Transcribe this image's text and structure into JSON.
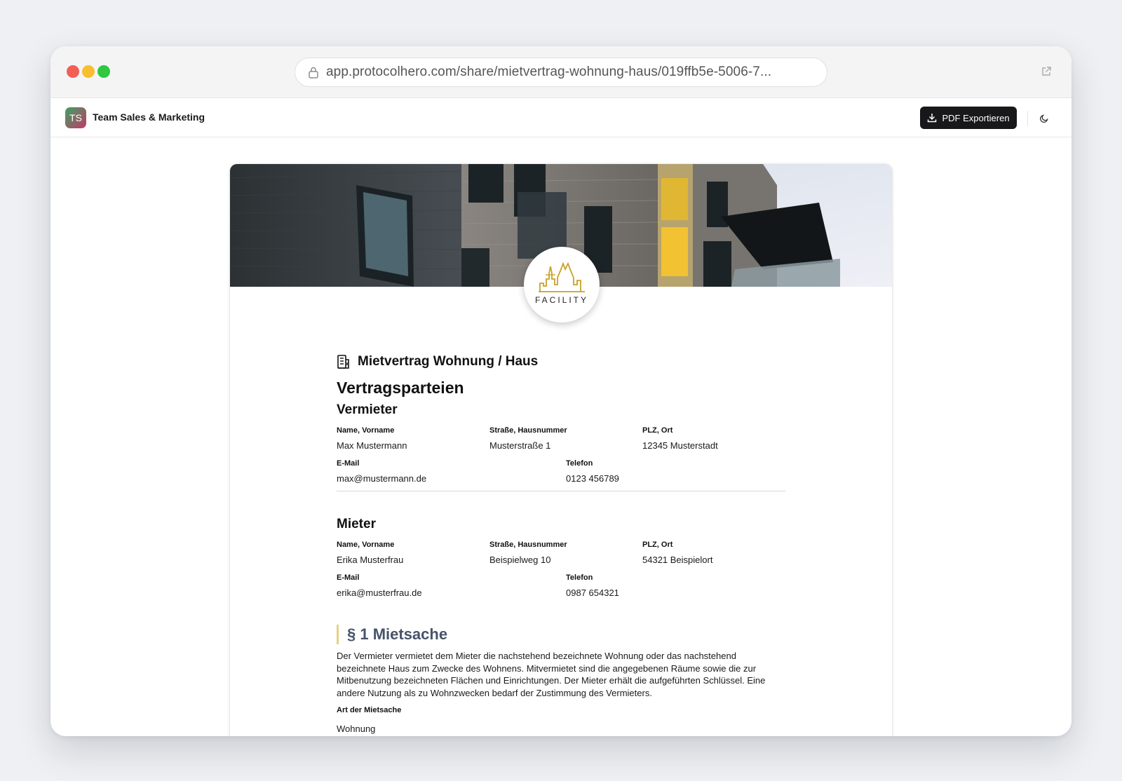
{
  "browser": {
    "url": "app.protocolhero.com/share/mietvertrag-wohnung-haus/019ffb5e-5006-7..."
  },
  "appbar": {
    "avatar_initials": "TS",
    "team_name": "Team Sales & Marketing",
    "pdf_button_label": "PDF Exportieren"
  },
  "logo": {
    "text": "FACILITY"
  },
  "document": {
    "title": "Mietvertrag Wohnung / Haus",
    "heading": "Vertragsparteien",
    "vermieter": {
      "heading": "Vermieter",
      "name_label": "Name, Vorname",
      "name": "Max Mustermann",
      "street_label": "Straße, Hausnummer",
      "street": "Musterstraße 1",
      "city_label": "PLZ, Ort",
      "city": "12345 Musterstadt",
      "email_label": "E-Mail",
      "email": "max@mustermann.de",
      "phone_label": "Telefon",
      "phone": "0123 456789"
    },
    "mieter": {
      "heading": "Mieter",
      "name_label": "Name, Vorname",
      "name": "Erika Musterfrau",
      "street_label": "Straße, Hausnummer",
      "street": "Beispielweg 10",
      "city_label": "PLZ, Ort",
      "city": "54321 Beispielort",
      "email_label": "E-Mail",
      "email": "erika@musterfrau.de",
      "phone_label": "Telefon",
      "phone": "0987 654321"
    },
    "section1": {
      "title": "§ 1 Mietsache",
      "text": "Der Vermieter vermietet dem Mieter die nachstehend bezeichnete Wohnung oder das nachstehend bezeichnete Haus zum Zwecke des Wohnens. Mitvermietet sind die angegebenen Räume sowie die zur Mitbenutzung bezeichneten Flächen und Einrichtungen. Der Mieter erhält die aufgeführten Schlüssel. Eine andere Nutzung als zu Wohnzwecken bedarf der Zustimmung des Vermieters.",
      "art_label": "Art der Mietsache",
      "art_value": "Wohnung"
    }
  },
  "colors": {
    "accent_bar": "#e8cf85",
    "section_title": "#46536a",
    "button_bg": "#18181b",
    "logo_gold": "#c9a227"
  }
}
